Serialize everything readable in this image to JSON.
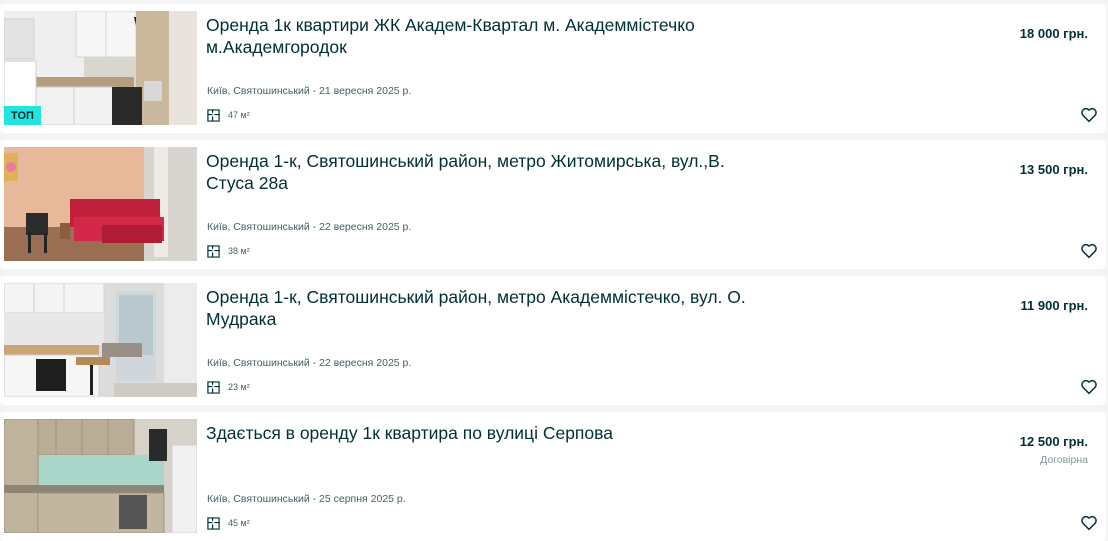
{
  "colors": {
    "background": "#f2f4f5",
    "card": "#ffffff",
    "text_primary": "#002f34",
    "text_secondary": "#406367",
    "badge": "#23e5db"
  },
  "listings": [
    {
      "title": "Оренда 1к квартири ЖК Академ-Квартал м. Академмістечко м.Академгородок",
      "location_date": "Київ, Святошинський - 21 вересня 2025 р.",
      "area": "47 м²",
      "price": "18 000 грн.",
      "negotiable": "",
      "badge": "ТОП",
      "image": "kitchen-white-photo",
      "favorite_icon": "heart-icon"
    },
    {
      "title": "Оренда 1-к, Святошинський район, метро Житомирська, вул.,В. Стуса 28а",
      "location_date": "Київ, Святошинський - 22 вересня 2025 р.",
      "area": "38 м²",
      "price": "13 500 грн.",
      "negotiable": "",
      "badge": "",
      "image": "red-sofa-room-photo",
      "favorite_icon": "heart-icon"
    },
    {
      "title": "Оренда 1-к, Святошинський район, метро Академмістечко, вул. О. Мудрака",
      "location_date": "Київ, Святошинський - 22 вересня 2025 р.",
      "area": "23 м²",
      "price": "11 900 грн.",
      "negotiable": "",
      "badge": "",
      "image": "studio-kitchen-photo",
      "favorite_icon": "heart-icon"
    },
    {
      "title": "Здається в оренду 1к квартира по вулиці Серпова",
      "location_date": "Київ, Святошинський - 25 серпня 2025 р.",
      "area": "45 м²",
      "price": "12 500 грн.",
      "negotiable": "Договірна",
      "badge": "",
      "image": "wood-kitchen-photo",
      "favorite_icon": "heart-icon"
    }
  ]
}
